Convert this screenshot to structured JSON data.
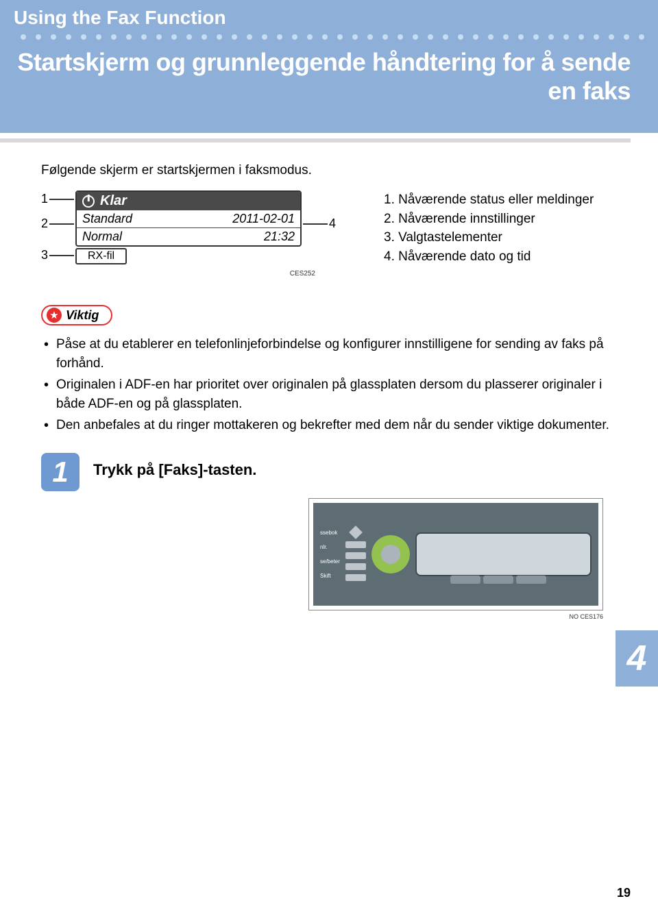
{
  "header": {
    "main_title": "Using the Fax Function",
    "subtitle": "Startskjerm og grunnleggende håndtering for å sende en faks"
  },
  "intro": "Følgende skjerm er startskjermen i faksmodus.",
  "lcd": {
    "status": "Klar",
    "mode": "Standard",
    "date": "2011-02-01",
    "quality": "Normal",
    "time": "21:32",
    "rxfile": "RX-fil",
    "callouts": {
      "c1": "1",
      "c2": "2",
      "c3": "3",
      "c4": "4"
    },
    "caption": "CES252"
  },
  "legend": [
    {
      "num": "1.",
      "text": "Nåværende status eller meldinger"
    },
    {
      "num": "2.",
      "text": "Nåværende innstillinger"
    },
    {
      "num": "3.",
      "text": "Valgtastelementer"
    },
    {
      "num": "4.",
      "text": "Nåværende dato og tid"
    }
  ],
  "important": {
    "label": "Viktig",
    "bullets": [
      "Påse at du etablerer en telefonlinjeforbindelse og konfigurer innstilligene for sending av faks på forhånd.",
      "Originalen i ADF-en har prioritet over originalen på glassplaten dersom du plasserer originaler i både ADF-en og på glassplaten.",
      "Den anbefales at du ringer mottakeren og bekrefter med dem når du sender viktige dokumenter."
    ]
  },
  "step": {
    "num": "1",
    "title": "Trykk på [Faks]-tasten."
  },
  "panel": {
    "labels": [
      "ssebok",
      "nlr.",
      "se/beter",
      "Skift"
    ],
    "caption": "NO CES176"
  },
  "chapter_tab": "4",
  "page_number": "19"
}
